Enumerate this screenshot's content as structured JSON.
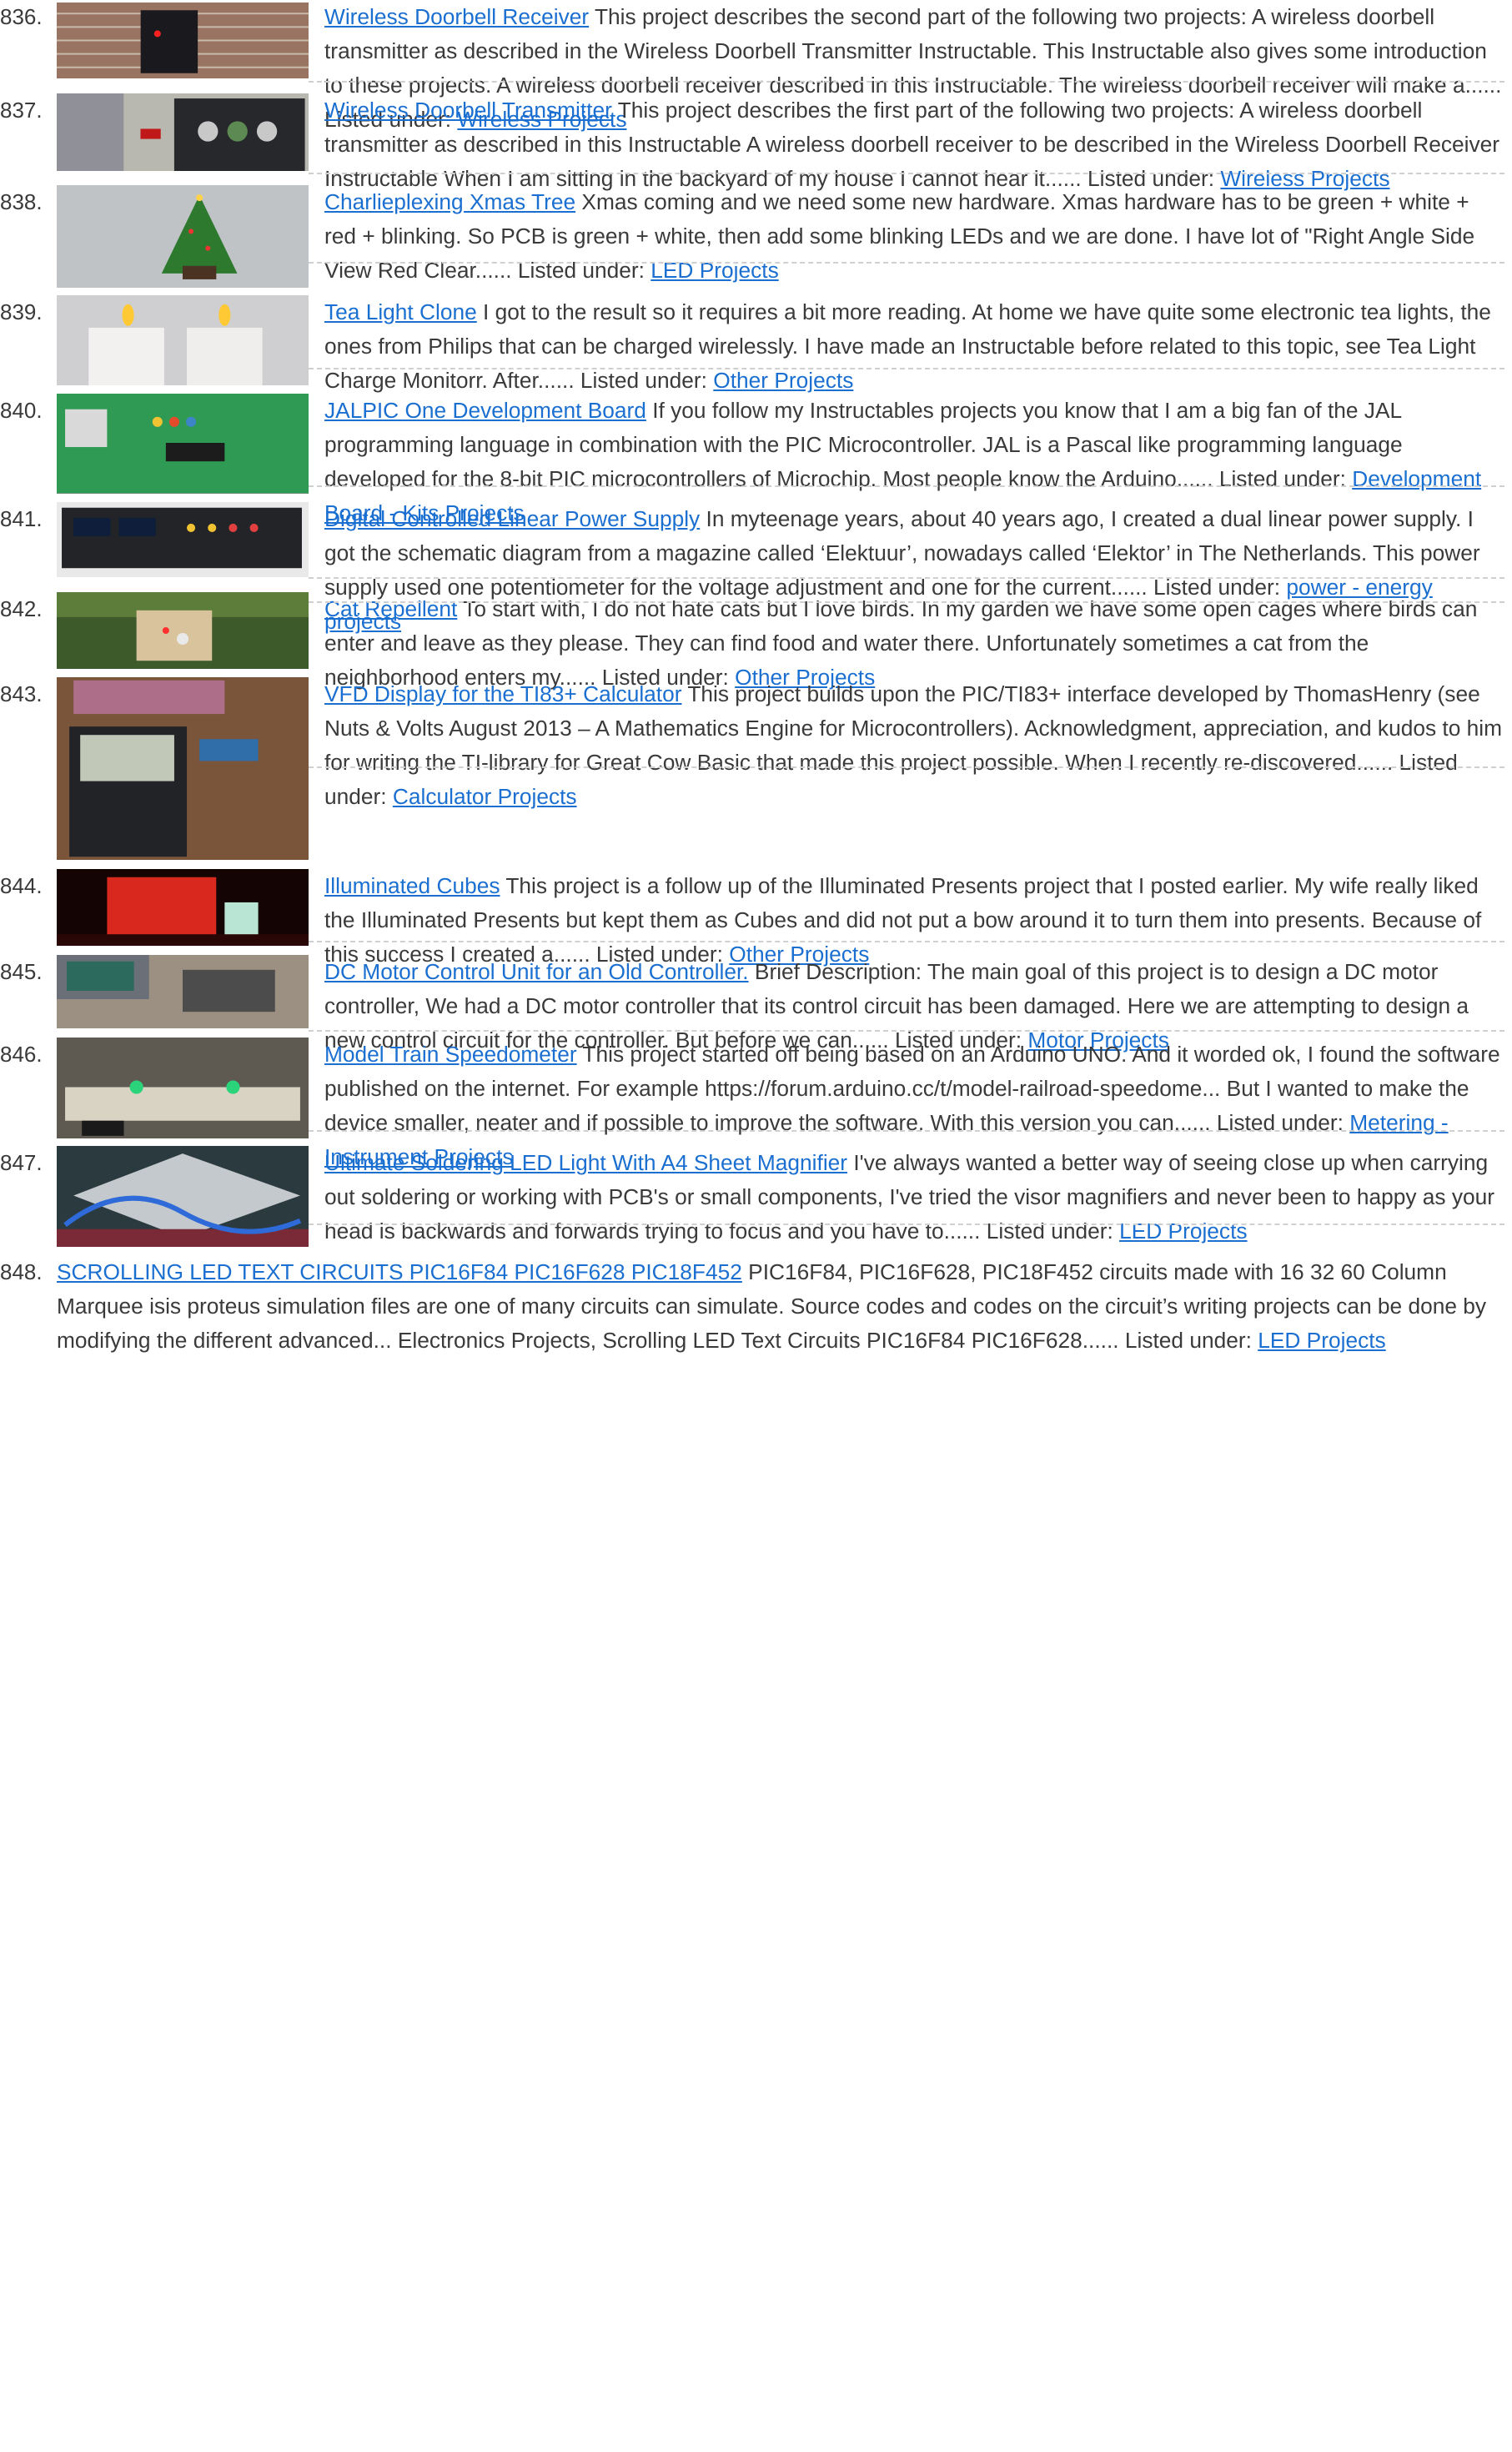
{
  "projects": [
    {
      "num": "836.",
      "title": "Wireless Doorbell Receiver",
      "desc": " This project describes the second part of the following two projects: A wireless doorbell transmitter as described in the Wireless Doorbell Transmitter Instructable. This Instructable also gives some introduction to these projects. A wireless doorbell receiver described in this Instructable. The wireless doorbell receiver will make a...... Listed under: ",
      "category": "Wireless Projects",
      "image": "doorbell-receiver-photo"
    },
    {
      "num": "837.",
      "title": "Wireless Doorbell Transmitter",
      "desc": " This project describes the first part of the following two projects: A wireless doorbell transmitter as described in this Instructable A wireless doorbell receiver to be described in the Wireless Doorbell Receiver Instructable When I am sitting in the backyard of my house I cannot hear it...... Listed under: ",
      "category": "Wireless Projects",
      "image": "doorbell-transmitter-photo"
    },
    {
      "num": "838.",
      "title": "Charlieplexing Xmas Tree",
      "desc": " Xmas coming and we need some new hardware. Xmas hardware has to be green + white + red + blinking. So PCB is green + white, then add some blinking LEDs and we are done. I have lot of \"Right Angle Side View Red Clear...... Listed under: ",
      "category": "LED Projects",
      "image": "xmas-tree-photo"
    },
    {
      "num": "839.",
      "title": "Tea Light Clone",
      "desc": " I got to the result so it requires a bit more reading. At home we have quite some electronic tea lights, the ones from Philips that can be charged wirelessly. I have made an Instructable before related to this topic, see Tea Light Charge Monitorr. After...... Listed under: ",
      "category": "Other Projects",
      "image": "tea-light-photo"
    },
    {
      "num": "840.",
      "title": "JALPIC One Development Board",
      "desc": " If you follow my Instructables projects you know that I am a big fan of the JAL programming language in combination with the PIC Microcontroller. JAL is a Pascal like programming language developed for the 8-bit PIC microcontrollers of Microchip. Most people know the Arduino...... Listed under: ",
      "category": "Development Board - Kits Projects",
      "image": "dev-board-photo"
    },
    {
      "num": "841.",
      "title": "Digital Controlled Linear Power Supply",
      "desc": " In myteenage years, about 40 years ago, I created a dual linear power supply. I got the schematic diagram from a magazine called ‘Elektuur’, nowadays called ‘Elektor’ in The Netherlands. This power supply used one potentiometer for the voltage adjustment and one for the current...... Listed under: ",
      "category": "power - energy projects",
      "image": "power-supply-photo"
    },
    {
      "num": "842.",
      "title": "Cat Repellent",
      "desc": " To start with, I do not hate cats but I love birds. In my garden we have some open cages where birds can enter and leave as they please. They can find food and water there. Unfortunately sometimes a cat from the neighborhood enters my...... Listed under: ",
      "category": "Other Projects",
      "image": "cat-repellent-photo"
    },
    {
      "num": "843.",
      "title": "VFD Display for the TI83+ Calculator",
      "desc": " This project builds upon the PIC/TI83+ interface developed by ThomasHenry (see Nuts & Volts August 2013 – A Mathematics Engine for Microcontrollers). Acknowledgment, appreciation, and kudos to him for writing the TI-library for Great Cow Basic that made this project possible. When I recently re-discovered...... Listed under: ",
      "category": "Calculator Projects",
      "image": "calculator-photo"
    },
    {
      "num": "844.",
      "title": "Illuminated Cubes",
      "desc": " This project is a follow up of the Illuminated Presents project that I posted earlier. My wife really liked the Illuminated Presents but kept them as Cubes and did not put a bow around it to turn them into presents. Because of this success I created a...... Listed under: ",
      "category": "Other Projects",
      "image": "cubes-photo"
    },
    {
      "num": "845.",
      "title": "DC Motor Control Unit for an Old Controller.",
      "desc": " Brief Description: The main goal of this project is to design a DC motor controller, We had a DC motor controller that its control circuit has been damaged. Here we are attempting to design a new control circuit for the controller. But before we can...... Listed under: ",
      "category": "Motor Projects",
      "image": "motor-control-photo"
    },
    {
      "num": "846.",
      "title": "Model Train Speedometer",
      "desc": " This project started off being based on an Arduino UNO. And it worded ok, I found the software published on the internet. For example https://forum.arduino.cc/t/model-railroad-speedome... But I wanted to make the device smaller, neater and if possible to improve the software. With this version you can...... Listed under: ",
      "category": "Metering - Instrument Projects",
      "image": "train-speedometer-photo"
    },
    {
      "num": "847.",
      "title": "Ultimate Soldering LED Light With A4 Sheet Magnifier",
      "desc": " I've always wanted a better way of seeing close up when carrying out soldering or working with PCB's or small components, I've tried the visor magnifiers and never been to happy as your head is backwards and forwards trying to focus and you have to...... Listed under: ",
      "category": "LED Projects",
      "image": "soldering-light-photo"
    },
    {
      "num": "848.",
      "title": "SCROLLING LED TEXT CIRCUITS PIC16F84 PIC16F628 PIC18F452",
      "desc": " PIC16F84, PIC16F628, PIC18F452 circuits made with 16 32 60 Column Marquee isis proteus simulation files are one of many circuits can simulate. Source codes and codes on the circuit’s writing projects can be done by modifying the different advanced... Electronics Projects, Scrolling LED Text Circuits PIC16F84 PIC16F628...... Listed under: ",
      "category": "LED Projects",
      "image": ""
    }
  ]
}
